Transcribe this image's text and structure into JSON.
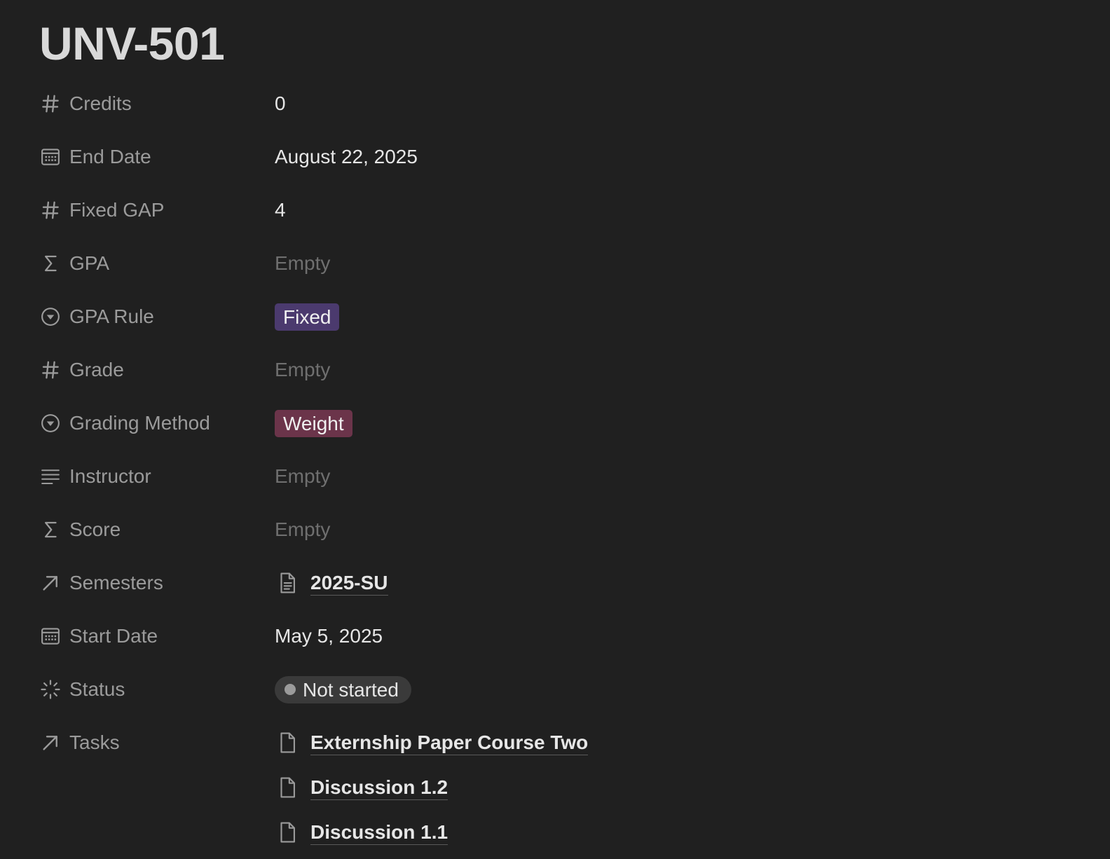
{
  "page": {
    "title": "UNV-501"
  },
  "properties": [
    {
      "label": "Credits",
      "icon": "number-icon",
      "type": "text",
      "value": "0"
    },
    {
      "label": "End Date",
      "icon": "calendar-icon",
      "type": "text",
      "value": "August 22, 2025"
    },
    {
      "label": "Fixed GAP",
      "icon": "number-icon",
      "type": "text",
      "value": "4"
    },
    {
      "label": "GPA",
      "icon": "sigma-icon",
      "type": "empty",
      "value": "Empty"
    },
    {
      "label": "GPA Rule",
      "icon": "select-icon",
      "type": "tag",
      "value": "Fixed",
      "color": "#4b3a6e"
    },
    {
      "label": "Grade",
      "icon": "number-icon",
      "type": "empty",
      "value": "Empty"
    },
    {
      "label": "Grading Method",
      "icon": "select-icon",
      "type": "tag",
      "value": "Weight",
      "color": "#6b344a"
    },
    {
      "label": "Instructor",
      "icon": "text-lines-icon",
      "type": "empty",
      "value": "Empty"
    },
    {
      "label": "Score",
      "icon": "sigma-icon",
      "type": "empty",
      "value": "Empty"
    },
    {
      "label": "Semesters",
      "icon": "relation-arrow-icon",
      "type": "relation",
      "items": [
        "2025-SU"
      ]
    },
    {
      "label": "Start Date",
      "icon": "calendar-icon",
      "type": "text",
      "value": "May 5, 2025"
    },
    {
      "label": "Status",
      "icon": "status-spinner-icon",
      "type": "status",
      "value": "Not started",
      "color": "#9b9b9b"
    },
    {
      "label": "Tasks",
      "icon": "relation-arrow-icon",
      "type": "relation",
      "items": [
        "Externship Paper Course Two",
        "Discussion 1.2",
        "Discussion 1.1"
      ]
    }
  ],
  "colors": {
    "background": "#202020",
    "label": "#9b9b9b",
    "value": "#e6e6e6",
    "empty": "#6f6f6f",
    "status_pill": "#3a3a3a"
  }
}
